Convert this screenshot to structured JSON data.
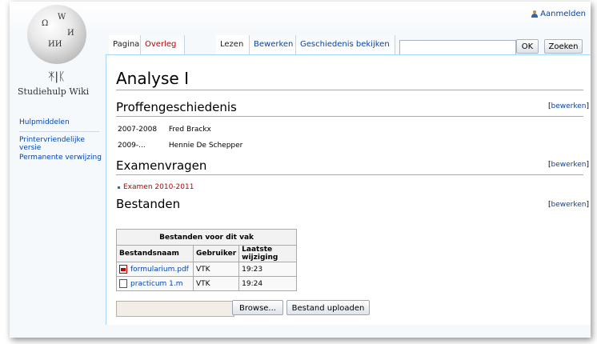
{
  "header": {
    "login_label": "Aanmelden"
  },
  "logo": {
    "name": "Studiehulp Wiki"
  },
  "sidebar": {
    "items": [
      {
        "label": "Hulpmiddelen"
      },
      {
        "label": "Printervriendelijke versie"
      },
      {
        "label": "Permanente verwijzing"
      }
    ]
  },
  "tabs": {
    "left": [
      {
        "label": "Pagina"
      },
      {
        "label": "Overleg"
      }
    ],
    "right": [
      {
        "label": "Lezen"
      },
      {
        "label": "Bewerken"
      },
      {
        "label": "Geschiedenis bekijken"
      }
    ]
  },
  "search": {
    "value": "",
    "ok_label": "OK",
    "search_label": "Zoeken"
  },
  "page": {
    "title": "Analyse I",
    "edit_label": "bewerken",
    "sections": [
      {
        "heading": "Proffengeschiedenis"
      },
      {
        "heading": "Examenvragen"
      },
      {
        "heading": "Bestanden"
      }
    ],
    "history": [
      {
        "years": "2007-2008",
        "name": "Fred Brackx"
      },
      {
        "years": "2009-...",
        "name": "Hennie De Schepper"
      }
    ],
    "exams": [
      {
        "label": "Examen 2010-2011"
      }
    ]
  },
  "files_table": {
    "caption": "Bestanden voor dit vak",
    "headers": [
      "Bestandsnaam",
      "Gebruiker",
      "Laatste wijziging"
    ],
    "rows": [
      {
        "name": "formularium.pdf",
        "user": "VTK",
        "modified": "19:23",
        "icon": "pdf-icon"
      },
      {
        "name": "practicum 1.m",
        "user": "VTK",
        "modified": "19:24",
        "icon": "document-icon"
      }
    ]
  },
  "upload": {
    "file_value": "",
    "browse_label": "Browse...",
    "upload_label": "Bestand uploaden"
  }
}
